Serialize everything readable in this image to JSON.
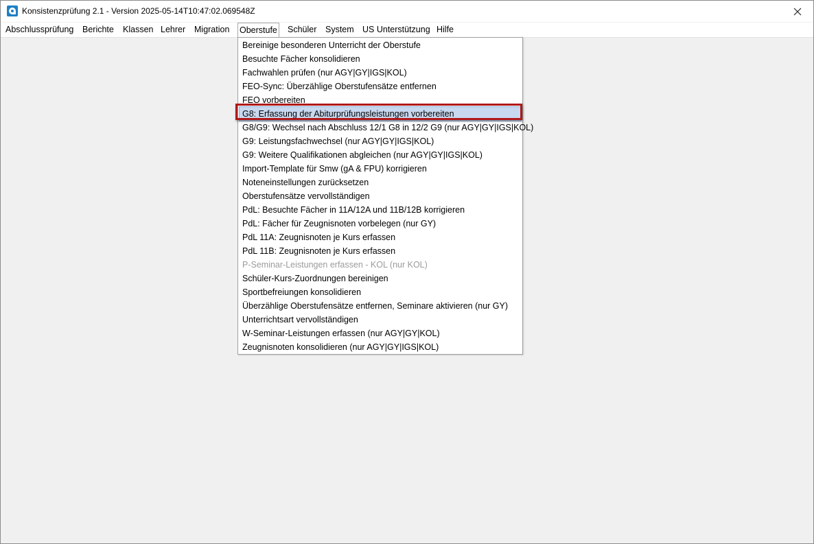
{
  "window": {
    "title": "Konsistenzprüfung 2.1 - Version 2025-05-14T10:47:02.069548Z",
    "app_icon": "app-logo-icon",
    "close_icon": "close-icon"
  },
  "menubar": {
    "items": [
      {
        "label": "Abschlussprüfung"
      },
      {
        "label": "Berichte"
      },
      {
        "label": "Klassen"
      },
      {
        "label": "Lehrer"
      },
      {
        "label": "Migration"
      },
      {
        "label": "Oberstufe"
      },
      {
        "label": "Schüler"
      },
      {
        "label": "System"
      },
      {
        "label": "US Unterstützung"
      },
      {
        "label": "Hilfe"
      }
    ],
    "open_menu": "Oberstufe"
  },
  "dropdown": {
    "items": [
      {
        "label": "Bereinige besonderen Unterricht der Oberstufe",
        "enabled": true
      },
      {
        "label": "Besuchte Fächer konsolidieren",
        "enabled": true
      },
      {
        "label": "Fachwahlen prüfen (nur AGY|GY|IGS|KOL)",
        "enabled": true
      },
      {
        "label": "FEO-Sync: Überzählige Oberstufensätze entfernen",
        "enabled": true
      },
      {
        "label": "FEO vorbereiten",
        "enabled": true
      },
      {
        "label": "G8: Erfassung der Abiturprüfungsleistungen vorbereiten",
        "enabled": true,
        "highlighted": true
      },
      {
        "label": "G8/G9: Wechsel nach Abschluss 12/1 G8 in 12/2 G9 (nur AGY|GY|IGS|KOL)",
        "enabled": true
      },
      {
        "label": "G9: Leistungsfachwechsel (nur AGY|GY|IGS|KOL)",
        "enabled": true
      },
      {
        "label": "G9: Weitere Qualifikationen abgleichen (nur AGY|GY|IGS|KOL)",
        "enabled": true
      },
      {
        "label": "Import-Template für Smw (gA & FPU) korrigieren",
        "enabled": true
      },
      {
        "label": "Noteneinstellungen zurücksetzen",
        "enabled": true
      },
      {
        "label": "Oberstufensätze vervollständigen",
        "enabled": true
      },
      {
        "label": "PdL: Besuchte Fächer in 11A/12A und 11B/12B korrigieren",
        "enabled": true
      },
      {
        "label": "PdL: Fächer für Zeugnisnoten vorbelegen (nur GY)",
        "enabled": true
      },
      {
        "label": "PdL 11A: Zeugnisnoten je Kurs erfassen",
        "enabled": true
      },
      {
        "label": "PdL 11B: Zeugnisnoten je Kurs erfassen",
        "enabled": true
      },
      {
        "label": "P-Seminar-Leistungen erfassen - KOL (nur KOL)",
        "enabled": false
      },
      {
        "label": "Schüler-Kurs-Zuordnungen bereinigen",
        "enabled": true
      },
      {
        "label": "Sportbefreiungen konsolidieren",
        "enabled": true
      },
      {
        "label": "Überzählige Oberstufensätze entfernen, Seminare aktivieren (nur GY)",
        "enabled": true
      },
      {
        "label": "Unterrichtsart vervollständigen",
        "enabled": true
      },
      {
        "label": "W-Seminar-Leistungen erfassen (nur AGY|GY|KOL)",
        "enabled": true
      },
      {
        "label": "Zeugnisnoten konsolidieren (nur AGY|GY|IGS|KOL)",
        "enabled": true
      }
    ]
  },
  "colors": {
    "highlight_bg": "#c8d8ef",
    "selection_border": "#b01818",
    "disabled_text": "#9b9b9b",
    "client_bg": "#f0f0f0"
  }
}
